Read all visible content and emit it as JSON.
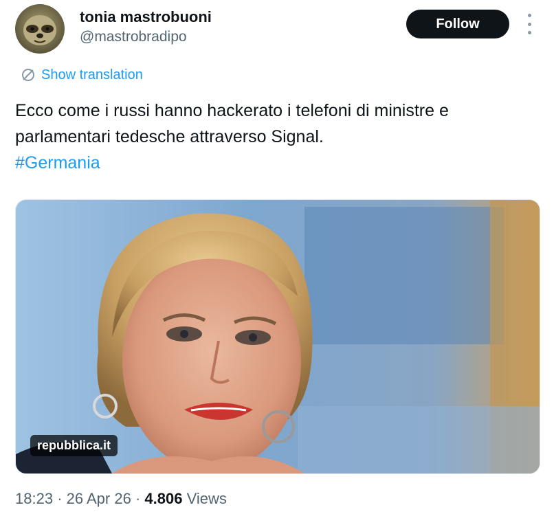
{
  "author": {
    "display_name": "tonia mastrobuoni",
    "handle": "@mastrobradipo"
  },
  "actions": {
    "follow_label": "Follow"
  },
  "translation": {
    "label": "Show translation"
  },
  "tweet": {
    "line1": "Ecco come i russi hanno hackerato i telefoni di ministre e",
    "line2": "parlamentari tedesche attraverso Signal.",
    "hashtag": "#Germania"
  },
  "media": {
    "source": "repubblica.it"
  },
  "meta": {
    "time": "18:23",
    "separator": "·",
    "date": "26 Apr 26",
    "views_count": "4.806",
    "views_label": "Views"
  },
  "colors": {
    "link": "#1d9bf0",
    "text": "#0f1419",
    "muted": "#536471",
    "button": "#0f1419"
  }
}
